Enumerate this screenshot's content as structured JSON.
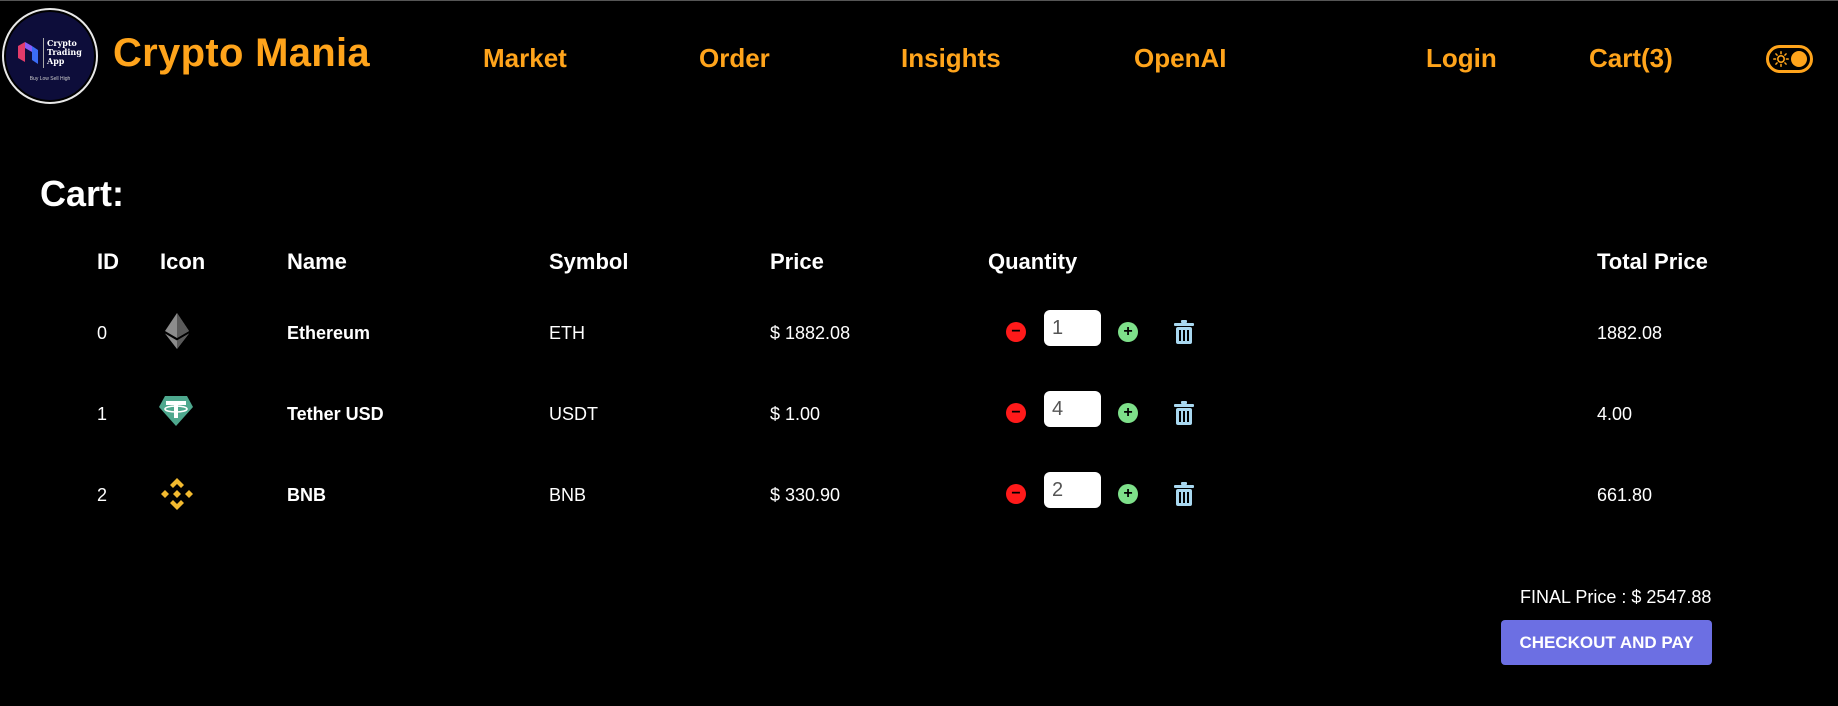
{
  "header": {
    "logo": {
      "line1": "Crypto",
      "line2": "Trading",
      "line3": "App",
      "tagline": "Buy Low Sell High"
    },
    "brand": "Crypto Mania",
    "nav": {
      "market": "Market",
      "order": "Order",
      "insights": "Insights",
      "openai": "OpenAI",
      "login": "Login",
      "cart": "Cart(3)"
    },
    "theme_toggle_icon": "sun-icon"
  },
  "cart": {
    "title": "Cart:",
    "columns": {
      "id": "ID",
      "icon": "Icon",
      "name": "Name",
      "symbol": "Symbol",
      "price": "Price",
      "quantity": "Quantity",
      "total": "Total Price"
    },
    "rows": [
      {
        "id": "0",
        "icon": "ethereum-icon",
        "name": "Ethereum",
        "symbol": "ETH",
        "price": "$ 1882.08",
        "quantity": "1",
        "total": "1882.08"
      },
      {
        "id": "1",
        "icon": "tether-icon",
        "name": "Tether USD",
        "symbol": "USDT",
        "price": "$ 1.00",
        "quantity": "4",
        "total": "4.00"
      },
      {
        "id": "2",
        "icon": "bnb-icon",
        "name": "BNB",
        "symbol": "BNB",
        "price": "$ 330.90",
        "quantity": "2",
        "total": "661.80"
      }
    ],
    "final_price": "FINAL Price : $ 2547.88",
    "checkout_label": "CHECKOUT AND PAY"
  },
  "colors": {
    "accent": "#ffa41b",
    "background": "#000000",
    "minus": "#ff1a1a",
    "plus": "#7ee08a",
    "trash": "#a9d8f0",
    "checkout": "#6c6fe3"
  }
}
